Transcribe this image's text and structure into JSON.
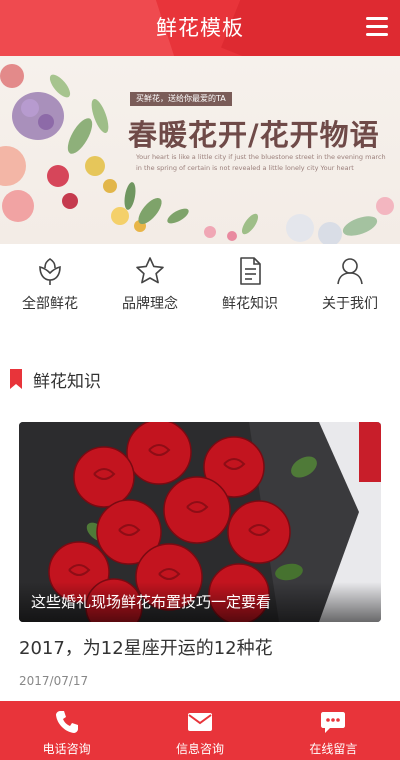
{
  "header": {
    "title": "鲜花模板",
    "menu_icon": "hamburger-menu-icon"
  },
  "banner": {
    "tag": "买鲜花，送给你最爱的TA",
    "headline": "春暖花开/花开物语",
    "subtext": "Your heart is like a little city if just the bluestone street in the evening march in the spring of certain is not revealed a little lonely city Your heart"
  },
  "categories": [
    {
      "label": "全部鲜花",
      "icon": "flower-icon"
    },
    {
      "label": "品牌理念",
      "icon": "star-icon"
    },
    {
      "label": "鲜花知识",
      "icon": "document-icon"
    },
    {
      "label": "关于我们",
      "icon": "user-icon"
    }
  ],
  "section": {
    "title": "鲜花知识"
  },
  "article": {
    "image_caption": "这些婚礼现场鲜花布置技巧一定要看",
    "title": "2017，为12星座开运的12种花",
    "date": "2017/07/17"
  },
  "bottom_nav": [
    {
      "label": "电话咨询",
      "icon": "phone-icon"
    },
    {
      "label": "信息咨询",
      "icon": "mail-icon"
    },
    {
      "label": "在线留言",
      "icon": "chat-icon"
    }
  ],
  "colors": {
    "accent": "#e8343a",
    "banner_headline": "#6f4a48"
  }
}
